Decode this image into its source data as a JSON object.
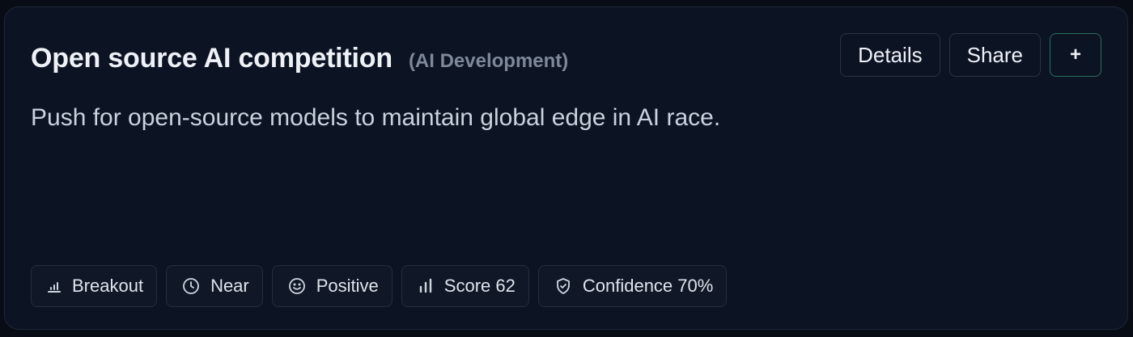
{
  "card": {
    "title": "Open source AI competition",
    "category": "(AI Development)",
    "description": "Push for open-source models to maintain global edge in AI race.",
    "accent_color": "#2d6e5e"
  },
  "actions": {
    "details_label": "Details",
    "share_label": "Share",
    "add_label": "+"
  },
  "tags": [
    {
      "icon": "bar-chart-icon",
      "label": "Breakout"
    },
    {
      "icon": "clock-icon",
      "label": "Near"
    },
    {
      "icon": "smile-icon",
      "label": "Positive"
    },
    {
      "icon": "bar-chart-icon",
      "label": "Score 62"
    },
    {
      "icon": "shield-check-icon",
      "label": "Confidence 70%"
    }
  ]
}
